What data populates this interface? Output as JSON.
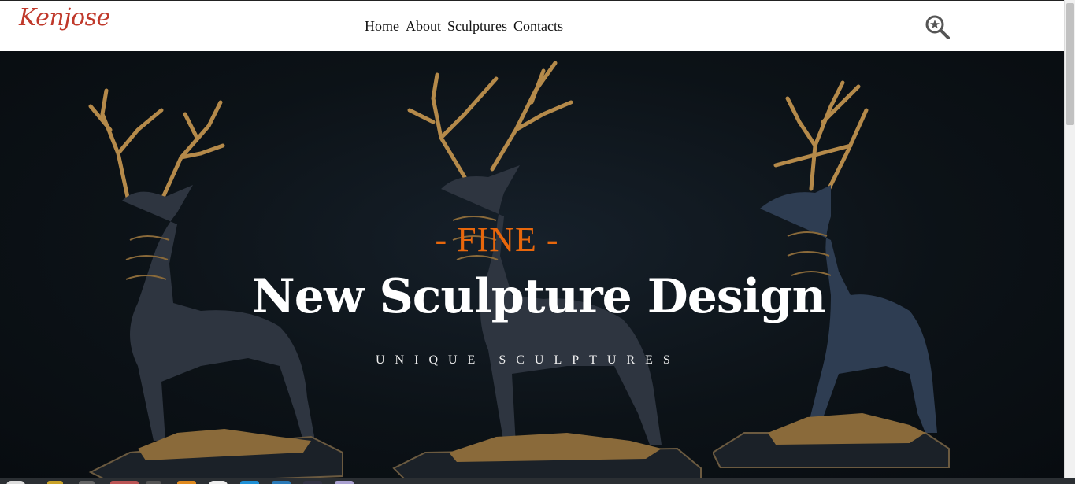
{
  "header": {
    "logo": "Kenjose",
    "nav": [
      "Home",
      "About",
      "Sculptures",
      "Contacts"
    ]
  },
  "hero": {
    "eyebrow": "- FINE -",
    "headline": "New Sculpture Design",
    "tagline": "UNIQUE SCULPTURES"
  },
  "icons": [
    "search-icon"
  ],
  "colors": {
    "logo": "#c0392b",
    "eyebrow": "#e8670c",
    "hero_bg": "#0c1217",
    "bronze": "#b58a4a",
    "statue_body": "#2e3540"
  }
}
